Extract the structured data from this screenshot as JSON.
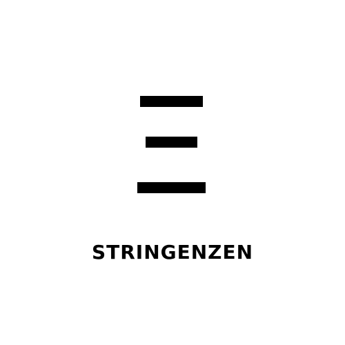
{
  "brand": {
    "name": "STRINGENZEN",
    "icon": "three-horizontal-bars-icon",
    "color": "#000000",
    "background": "#ffffff"
  }
}
